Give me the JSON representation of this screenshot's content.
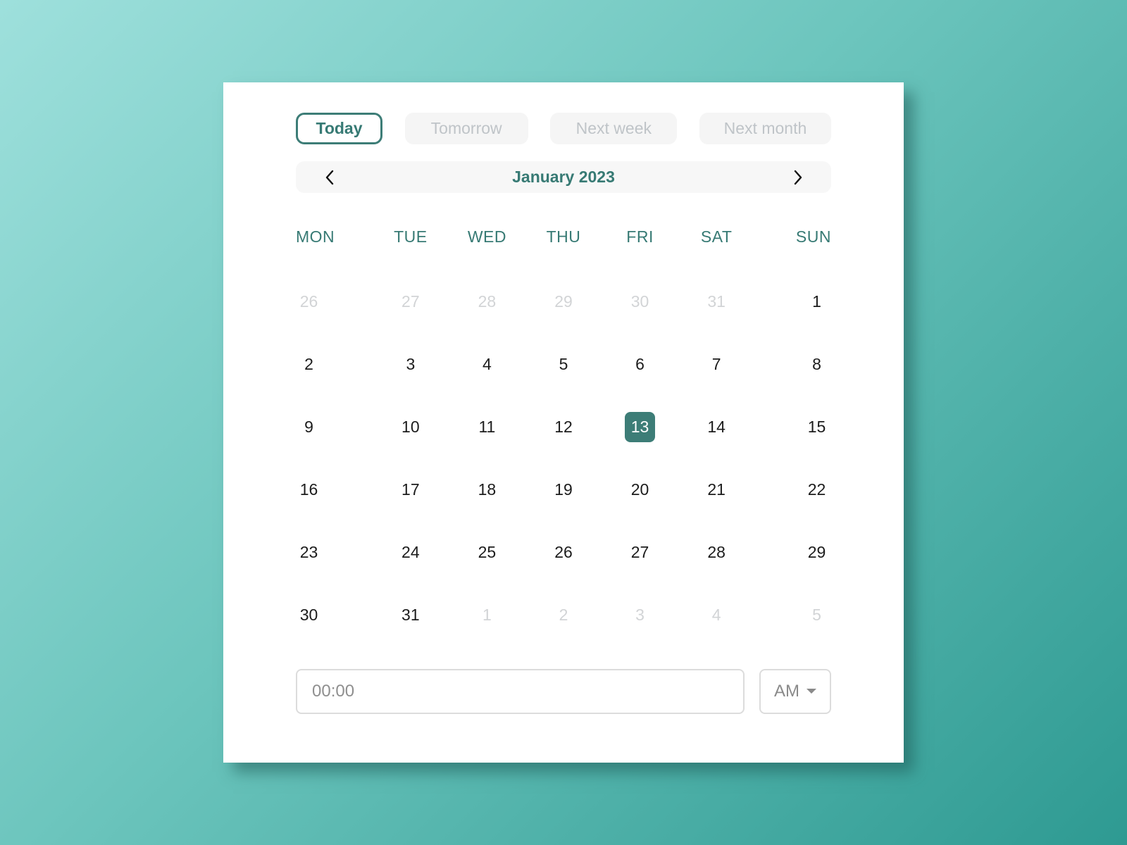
{
  "quick_select": [
    {
      "label": "Today",
      "active": true
    },
    {
      "label": "Tomorrow",
      "active": false
    },
    {
      "label": "Next week",
      "active": false
    },
    {
      "label": "Next month",
      "active": false
    }
  ],
  "nav": {
    "month_label": "January 2023",
    "prev_icon": "chevron-left-icon",
    "next_icon": "chevron-right-icon"
  },
  "weekdays": [
    "MON",
    "TUE",
    "WED",
    "THU",
    "FRI",
    "SAT",
    "SUN"
  ],
  "days": [
    {
      "n": "26",
      "muted": true
    },
    {
      "n": "27",
      "muted": true
    },
    {
      "n": "28",
      "muted": true
    },
    {
      "n": "29",
      "muted": true
    },
    {
      "n": "30",
      "muted": true
    },
    {
      "n": "31",
      "muted": true
    },
    {
      "n": "1"
    },
    {
      "n": "2"
    },
    {
      "n": "3"
    },
    {
      "n": "4"
    },
    {
      "n": "5"
    },
    {
      "n": "6"
    },
    {
      "n": "7"
    },
    {
      "n": "8"
    },
    {
      "n": "9"
    },
    {
      "n": "10"
    },
    {
      "n": "11"
    },
    {
      "n": "12"
    },
    {
      "n": "13",
      "selected": true
    },
    {
      "n": "14"
    },
    {
      "n": "15"
    },
    {
      "n": "16"
    },
    {
      "n": "17"
    },
    {
      "n": "18"
    },
    {
      "n": "19"
    },
    {
      "n": "20"
    },
    {
      "n": "21"
    },
    {
      "n": "22"
    },
    {
      "n": "23"
    },
    {
      "n": "24"
    },
    {
      "n": "25"
    },
    {
      "n": "26"
    },
    {
      "n": "27"
    },
    {
      "n": "28"
    },
    {
      "n": "29"
    },
    {
      "n": "30"
    },
    {
      "n": "31"
    },
    {
      "n": "1",
      "muted": true
    },
    {
      "n": "2",
      "muted": true
    },
    {
      "n": "3",
      "muted": true
    },
    {
      "n": "4",
      "muted": true
    },
    {
      "n": "5",
      "muted": true
    }
  ],
  "time": {
    "value": "",
    "placeholder": "00:00",
    "period": "AM",
    "period_icon": "caret-down-icon"
  },
  "colors": {
    "accent": "#3d7d77",
    "muted_text": "#d2d4d6",
    "bg_start": "#9ee0dc",
    "bg_end": "#2e9a92"
  }
}
